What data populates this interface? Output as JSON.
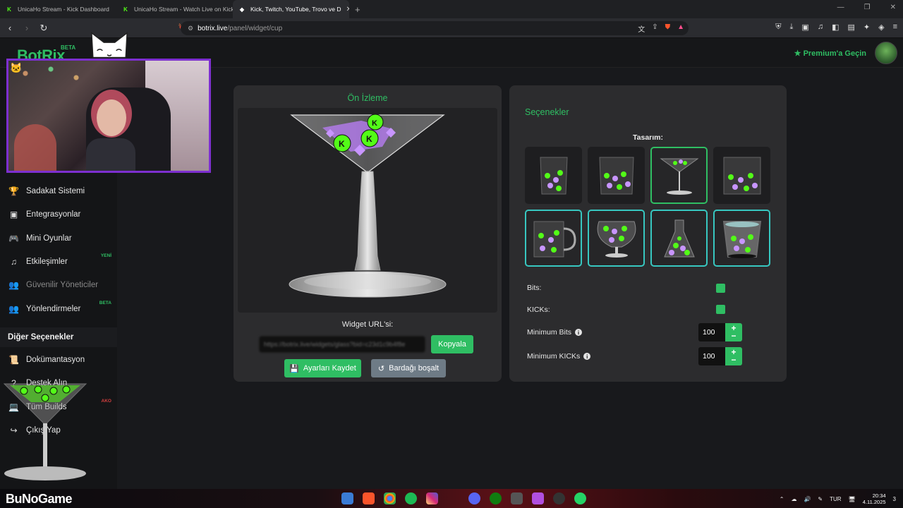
{
  "browser": {
    "tabs": [
      {
        "title": "UnicaHo Stream - Kick Dashboard",
        "favicon": "K"
      },
      {
        "title": "UnicaHo Stream - Watch Live on Kick",
        "favicon": "K"
      },
      {
        "title": "Kick, Twitch, YouTube, Trovo ve D",
        "favicon": "◆"
      }
    ],
    "url_host": "botrix.live",
    "url_path": "/panel/widget/cup"
  },
  "header": {
    "logo": "BotRix",
    "logo_badge": "BETA",
    "premium_label": "Premium'a Geçin"
  },
  "sidebar": {
    "items": [
      {
        "label": "Sadakat Sistemi",
        "icon": "trophy-icon",
        "glyph": "🏆",
        "badge": ""
      },
      {
        "label": "Entegrasyonlar",
        "icon": "window-icon",
        "glyph": "▣",
        "badge": ""
      },
      {
        "label": "Mini Oyunlar",
        "icon": "gamepad-icon",
        "glyph": "🎮",
        "badge": ""
      },
      {
        "label": "Etkileşimler",
        "icon": "music-icon",
        "glyph": "♫",
        "badge": "YENİ"
      },
      {
        "label": "Güvenilir Yöneticiler",
        "icon": "users-icon",
        "glyph": "👥",
        "badge": ""
      },
      {
        "label": "Yönlendirmeler",
        "icon": "user-group-icon",
        "glyph": "👥",
        "badge": "BETA"
      }
    ],
    "section_title": "Diğer Seçenekler",
    "other_items": [
      {
        "label": "Dokümantasyon",
        "icon": "scroll-icon",
        "glyph": "📜",
        "badge": ""
      },
      {
        "label": "Destek Alın",
        "icon": "question-icon",
        "glyph": "?",
        "badge": ""
      },
      {
        "label": "Tüm Builds",
        "icon": "laptop-icon",
        "glyph": "💻",
        "badge": "AKO"
      },
      {
        "label": "Çıkış Yap",
        "icon": "logout-icon",
        "glyph": "↪",
        "badge": ""
      }
    ]
  },
  "preview": {
    "title": "Ön İzleme",
    "widget_url_label": "Widget URL'si:",
    "widget_url_value": "https://botrix.live/widgets/glass?bid=c23d1c9b4f8e",
    "copy_button": "Kopyala",
    "save_button": "Ayarları Kaydet",
    "empty_button": "Bardağı boşalt"
  },
  "options": {
    "title": "Seçenekler",
    "design_label": "Tasarım:",
    "designs": [
      {
        "name": "tall-glass",
        "selected": false
      },
      {
        "name": "wide-jar",
        "selected": false
      },
      {
        "name": "martini-glass",
        "selected": true
      },
      {
        "name": "square-jar",
        "selected": false
      },
      {
        "name": "mug",
        "selected": false
      },
      {
        "name": "snifter",
        "selected": false
      },
      {
        "name": "flask",
        "selected": false
      },
      {
        "name": "bucket",
        "selected": false
      }
    ],
    "bits_label": "Bits:",
    "bits_checked": true,
    "kicks_label": "KICKs:",
    "kicks_checked": true,
    "min_bits_label": "Minimum Bits",
    "min_bits_value": "100",
    "min_kicks_label": "Minimum KICKs",
    "min_kicks_value": "100"
  },
  "overlay": {
    "brand": "BuNoGame"
  },
  "taskbar": {
    "lang": "TUR",
    "time": "20:34",
    "date": "4.11.2025",
    "notifications": "3"
  },
  "colors": {
    "accent": "#2fbe63",
    "teal_border": "#37c7c0",
    "webcam_border": "#7d2fd0"
  }
}
